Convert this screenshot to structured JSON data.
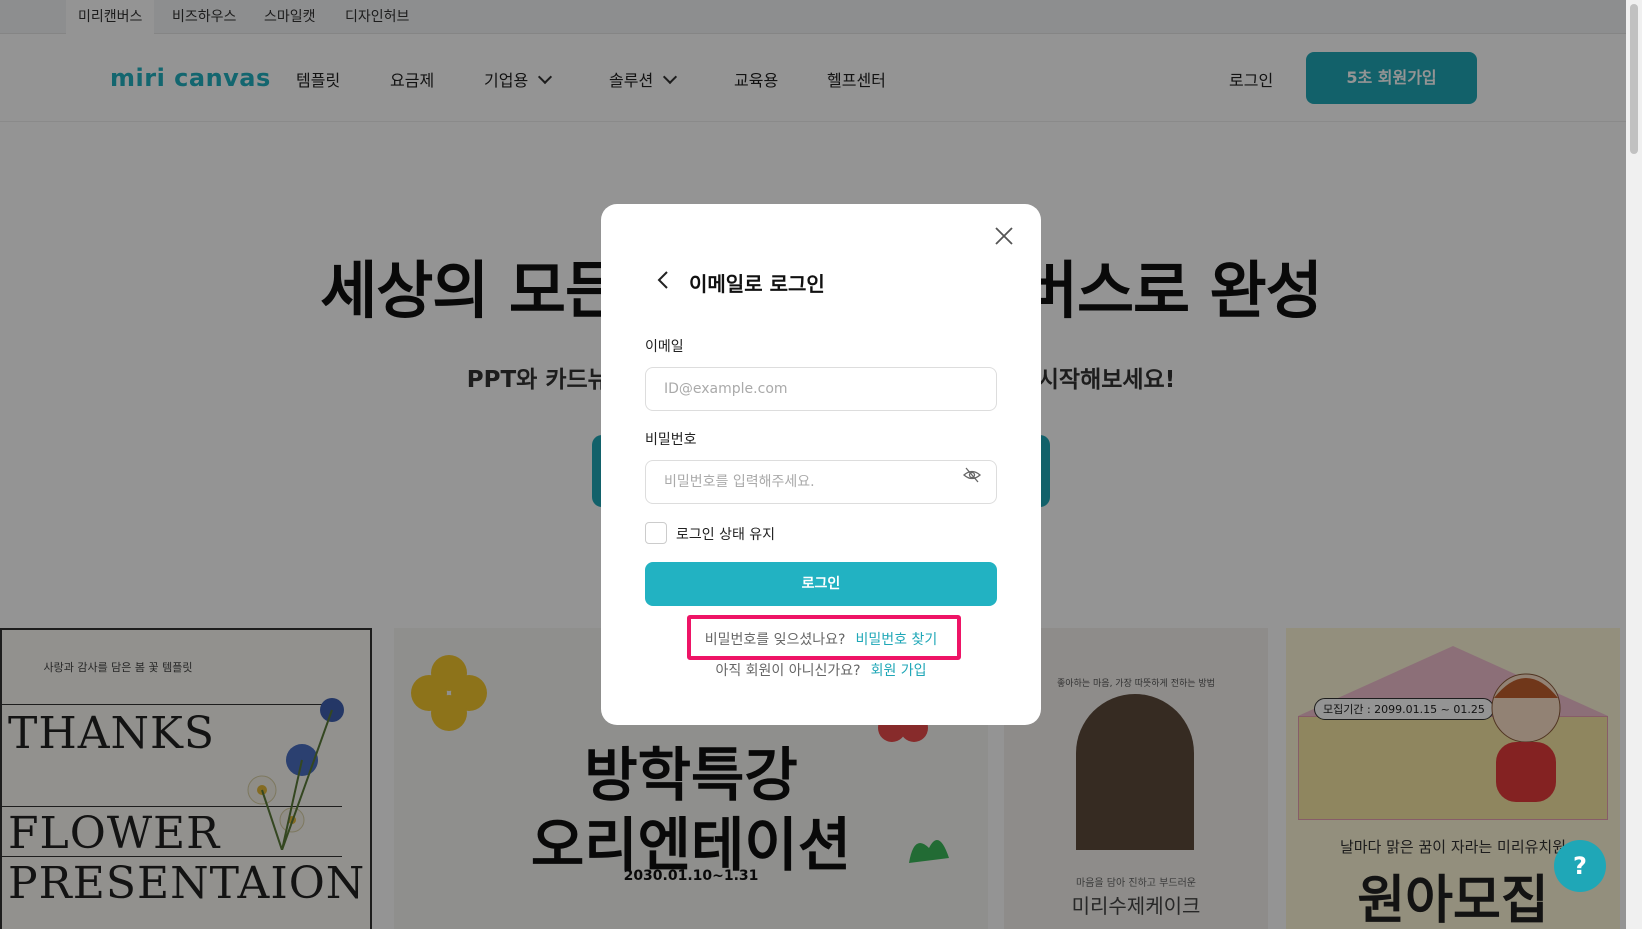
{
  "brand_tabs": [
    "미리캔버스",
    "비즈하우스",
    "스마일캣",
    "디자인허브"
  ],
  "nav": {
    "logo_text": "miri canvas",
    "items": [
      "템플릿",
      "요금제",
      "기업용",
      "솔루션",
      "교육용",
      "헬프센터"
    ],
    "login": "로그인",
    "signup": "5초 회원가입"
  },
  "hero": {
    "title": "세상의 모든 디자인, 미리캔버스로 완성",
    "subtitle": "PPT와 카드뉴스부터 영상까지 무료 템플릿으로 지금 쉽게 시작해보세요!"
  },
  "cards": {
    "thanks": {
      "small": "사랑과 감사를 담은 봄 꽃 템플릿",
      "line1": "THANKS",
      "line2": "FLOWER",
      "line3": "PRESENTAION"
    },
    "afterschool": {
      "title1": "방학특강",
      "title2": "오리엔테이션",
      "date": "2030.01.10~1.31"
    },
    "cake": {
      "small": "좋아하는 마음, 가장 따뜻하게 전하는 방법",
      "caption1": "마음을 담아 진하고 부드러운",
      "caption2": "미리수제케이크"
    },
    "kindergarten": {
      "period": "모집기간 : 2099.01.15 ~ 01.25",
      "sub": "날마다 맑은 꿈이 자라는 미리유치원",
      "title": "원아모집"
    }
  },
  "help_fab": "?",
  "modal": {
    "title": "이메일로 로그인",
    "email_label": "이메일",
    "email_placeholder": "ID@example.com",
    "email_value": "",
    "password_label": "비밀번호",
    "password_placeholder": "비밀번호를 입력해주세요.",
    "password_value": "",
    "keep_login": "로그인 상태 유지",
    "keep_login_checked": false,
    "login_button": "로그인",
    "forgot_question": "비밀번호를 잊으셨나요?",
    "forgot_link": "비밀번호 찾기",
    "signup_question": "아직 회원이 아니신가요?",
    "signup_link": "회원 가입"
  },
  "colors": {
    "accent": "#1fa7b7",
    "highlight": "#ee1466",
    "overlay": "rgba(0,0,0,0.42)"
  }
}
